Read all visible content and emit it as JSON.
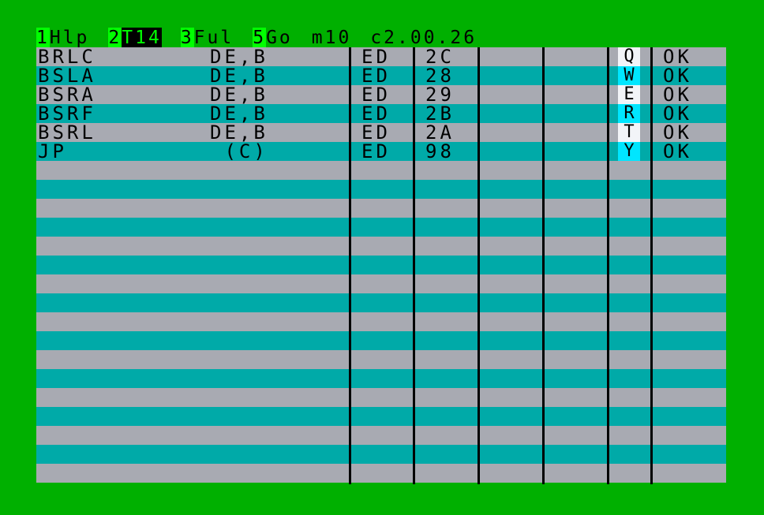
{
  "colors": {
    "border": "#00b000",
    "key_highlight": "#00ff00",
    "row_grey": "#a8aab2",
    "row_teal": "#00aaa8",
    "key_light": "#f2f4f8",
    "key_cyan": "#00e6ff"
  },
  "menubar": {
    "f1_key": "1",
    "f1_label": "Hlp",
    "f2_key": "2",
    "f2_label": "T14",
    "f3_key": "3",
    "f3_label": "Ful",
    "f5_key": "5",
    "f5_label": "Go",
    "mode": "m10",
    "version": "c2.00.26"
  },
  "table": {
    "row_count": 23,
    "rows": [
      {
        "mnemonic": "BRLC",
        "operand": "DE,B",
        "prefix": "ED",
        "opcode": "2C",
        "key": "Q",
        "status": "OK"
      },
      {
        "mnemonic": "BSLA",
        "operand": "DE,B",
        "prefix": "ED",
        "opcode": "28",
        "key": "W",
        "status": "OK"
      },
      {
        "mnemonic": "BSRA",
        "operand": "DE,B",
        "prefix": "ED",
        "opcode": "29",
        "key": "E",
        "status": "OK"
      },
      {
        "mnemonic": "BSRF",
        "operand": "DE,B",
        "prefix": "ED",
        "opcode": "2B",
        "key": "R",
        "status": "OK"
      },
      {
        "mnemonic": "BSRL",
        "operand": "DE,B",
        "prefix": "ED",
        "opcode": "2A",
        "key": "T",
        "status": "OK"
      },
      {
        "mnemonic": "JP",
        "operand": " (C)",
        "prefix": "ED",
        "opcode": "98",
        "key": "Y",
        "status": "OK"
      }
    ]
  }
}
